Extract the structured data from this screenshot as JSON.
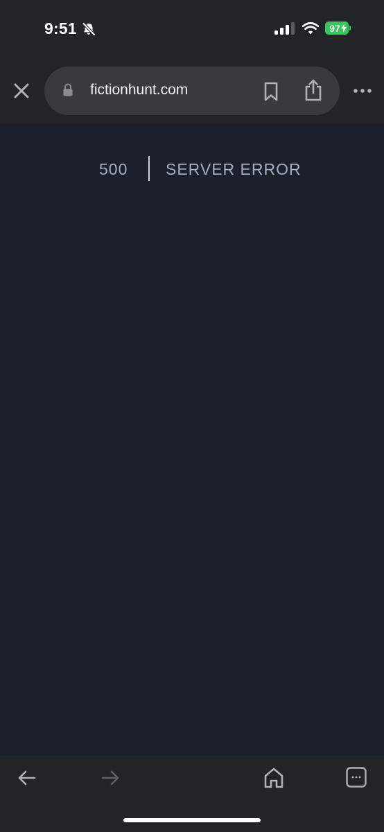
{
  "status_bar": {
    "time": "9:51",
    "battery": "97",
    "icons": [
      "bell-slash-icon",
      "signal-icon",
      "wifi-icon",
      "battery-icon"
    ]
  },
  "browser": {
    "url": "fictionhunt.com",
    "icons": [
      "close-icon",
      "lock-icon",
      "bookmark-icon",
      "share-icon",
      "more-icon"
    ]
  },
  "page": {
    "error_code": "500",
    "error_message": "SERVER ERROR"
  },
  "toolbar": {
    "icons": [
      "back-arrow-icon",
      "forward-arrow-icon",
      "home-icon",
      "tabs-icon"
    ]
  },
  "colors": {
    "page_background": "#1b202b",
    "chrome_background": "#232428",
    "url_bar_background": "#393a3e",
    "error_text": "#a0aec0",
    "battery_green": "#34c759"
  }
}
